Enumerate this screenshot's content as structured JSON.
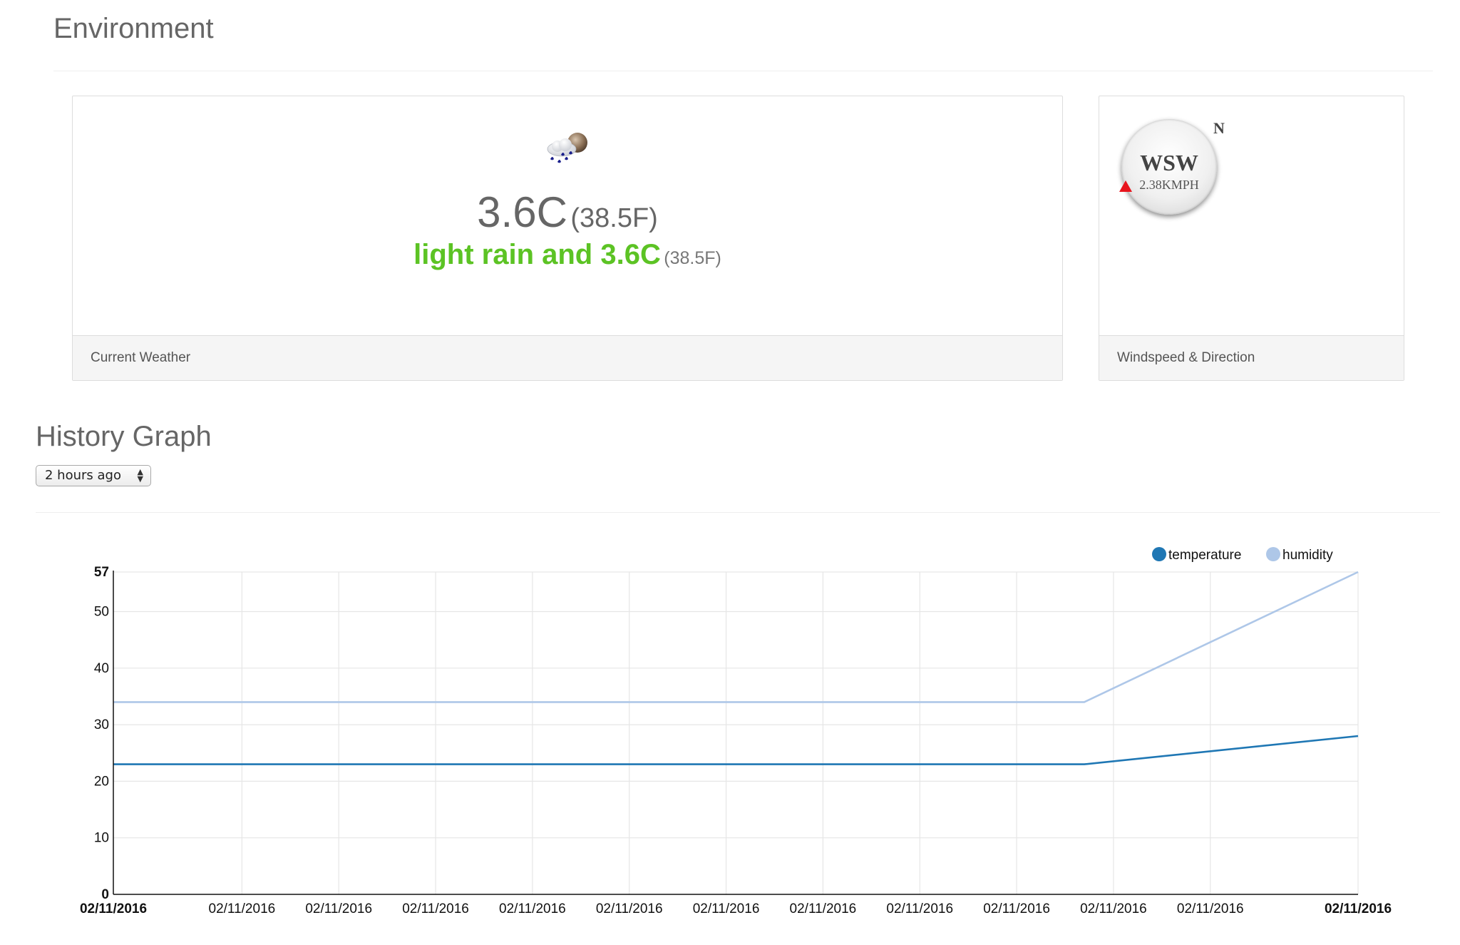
{
  "environment": {
    "title": "Environment"
  },
  "current_weather": {
    "icon": "cloud-rain-moon-icon",
    "temp_c": "3.6C",
    "temp_f": "(38.5F)",
    "condition": "light rain and 3.6C",
    "condition_f": "(38.5F)",
    "footer": "Current Weather",
    "accent_color": "#5cc324"
  },
  "wind": {
    "north_label": "N",
    "direction": "WSW",
    "speed": "2.38KMPH",
    "footer": "Windspeed & Direction",
    "arrow_color": "#e8141c"
  },
  "history": {
    "title": "History Graph",
    "range_select": {
      "value": "2 hours ago"
    }
  },
  "chart_data": {
    "type": "line",
    "ylim": [
      0,
      57
    ],
    "yticks": [
      "0",
      "10",
      "20",
      "30",
      "40",
      "50",
      "57"
    ],
    "yticks_values": [
      0,
      10,
      20,
      30,
      40,
      50,
      57
    ],
    "x_labels": [
      "02/11/2016",
      "02/11/2016",
      "02/11/2016",
      "02/11/2016",
      "02/11/2016",
      "02/11/2016",
      "02/11/2016",
      "02/11/2016",
      "02/11/2016",
      "02/11/2016",
      "02/11/2016",
      "02/11/2016",
      "02/11/2016"
    ],
    "x_label_bold": [
      true,
      false,
      false,
      false,
      false,
      false,
      false,
      false,
      false,
      false,
      false,
      false,
      true
    ],
    "x_positions": [
      0,
      0.1033,
      0.1811,
      0.2589,
      0.3367,
      0.4145,
      0.4923,
      0.5701,
      0.6479,
      0.7257,
      0.8035,
      0.8813,
      1
    ],
    "grid": true,
    "legend_placement": "top-right",
    "series": [
      {
        "name": "temperature",
        "color": "#1f77b4",
        "points": [
          [
            0,
            23
          ],
          [
            0.78,
            23
          ],
          [
            1,
            28
          ]
        ]
      },
      {
        "name": "humidity",
        "color": "#aec7e8",
        "points": [
          [
            0,
            34
          ],
          [
            0.78,
            34
          ],
          [
            1,
            57
          ]
        ]
      }
    ]
  }
}
